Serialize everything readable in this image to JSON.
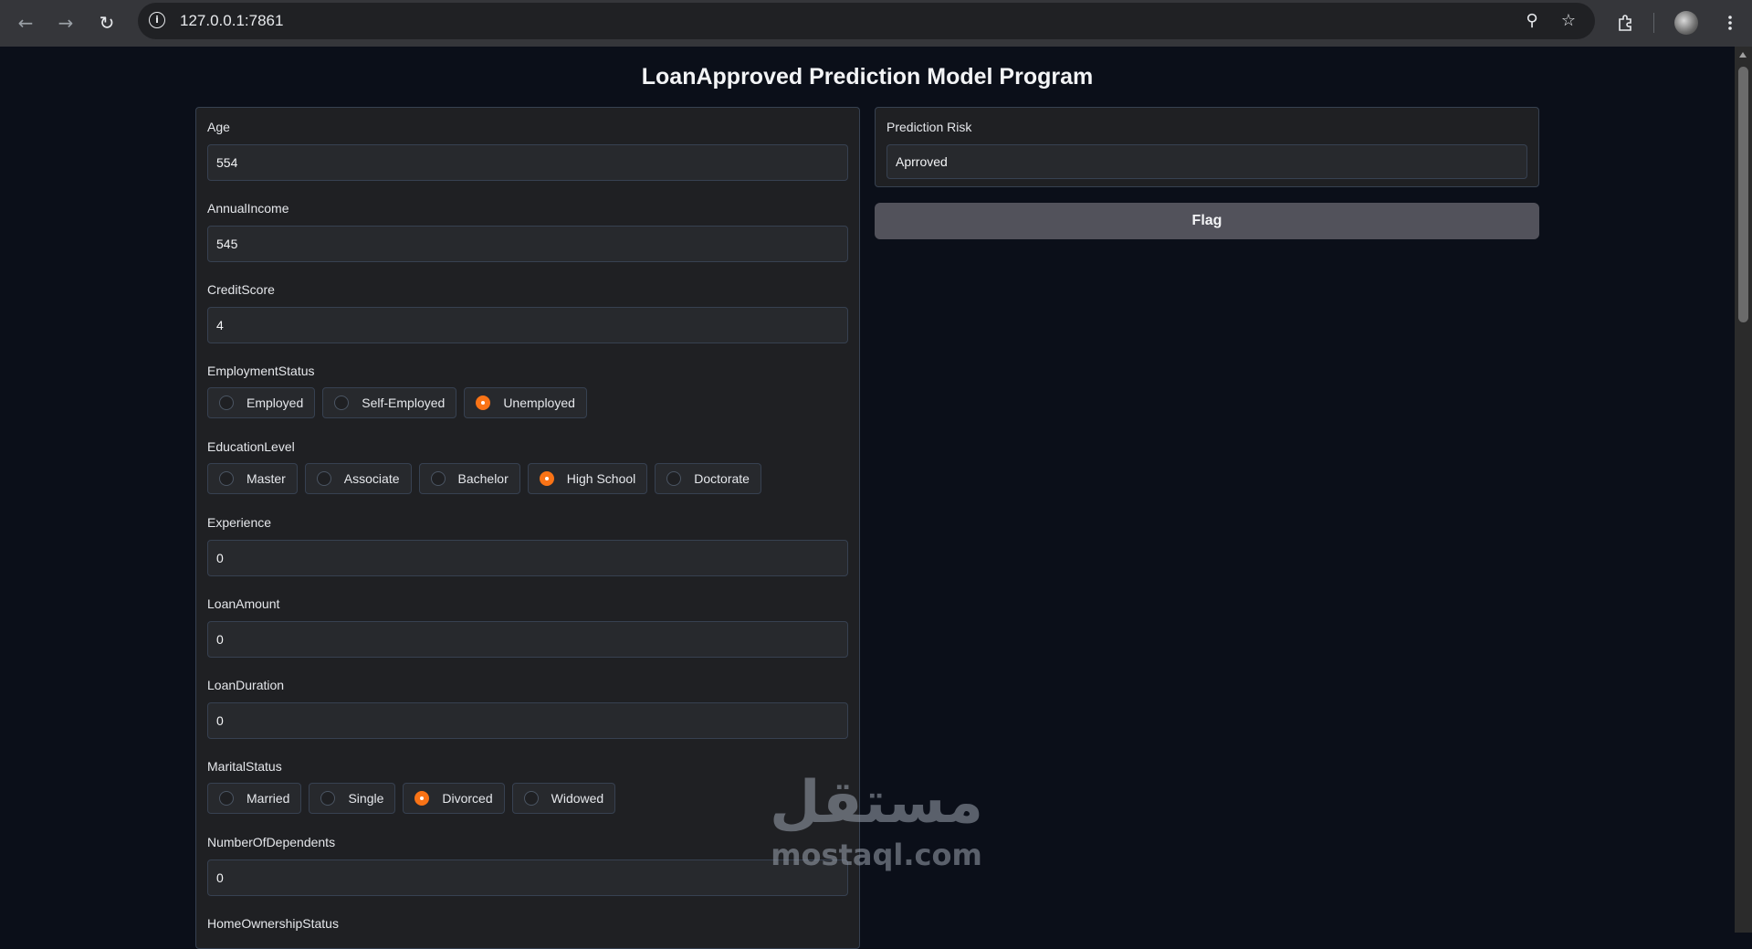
{
  "browser": {
    "url": "127.0.0.1:7861"
  },
  "app": {
    "title": "LoanApproved Prediction Model Program"
  },
  "fields": {
    "age": {
      "label": "Age",
      "value": "554"
    },
    "annual_income": {
      "label": "AnnualIncome",
      "value": "545"
    },
    "credit_score": {
      "label": "CreditScore",
      "value": "4"
    },
    "employment_status": {
      "label": "EmploymentStatus",
      "options": [
        "Employed",
        "Self-Employed",
        "Unemployed"
      ],
      "selected": "Unemployed"
    },
    "education_level": {
      "label": "EducationLevel",
      "options": [
        "Master",
        "Associate",
        "Bachelor",
        "High School",
        "Doctorate"
      ],
      "selected": "High School"
    },
    "experience": {
      "label": "Experience",
      "value": "0"
    },
    "loan_amount": {
      "label": "LoanAmount",
      "value": "0"
    },
    "loan_duration": {
      "label": "LoanDuration",
      "value": "0"
    },
    "marital_status": {
      "label": "MaritalStatus",
      "options": [
        "Married",
        "Single",
        "Divorced",
        "Widowed"
      ],
      "selected": "Divorced"
    },
    "number_of_dependents": {
      "label": "NumberOfDependents",
      "value": "0"
    },
    "home_ownership_status": {
      "label": "HomeOwnershipStatus"
    }
  },
  "output": {
    "label": "Prediction Risk",
    "value": "Aprroved"
  },
  "flag_button": "Flag",
  "watermark": {
    "arabic": "مستقل",
    "latin": "mostaql.com"
  },
  "colors": {
    "accent": "#f97316",
    "page_bg": "#0b0f19",
    "panel_bg": "#1f2023",
    "button_bg": "#52525b"
  }
}
